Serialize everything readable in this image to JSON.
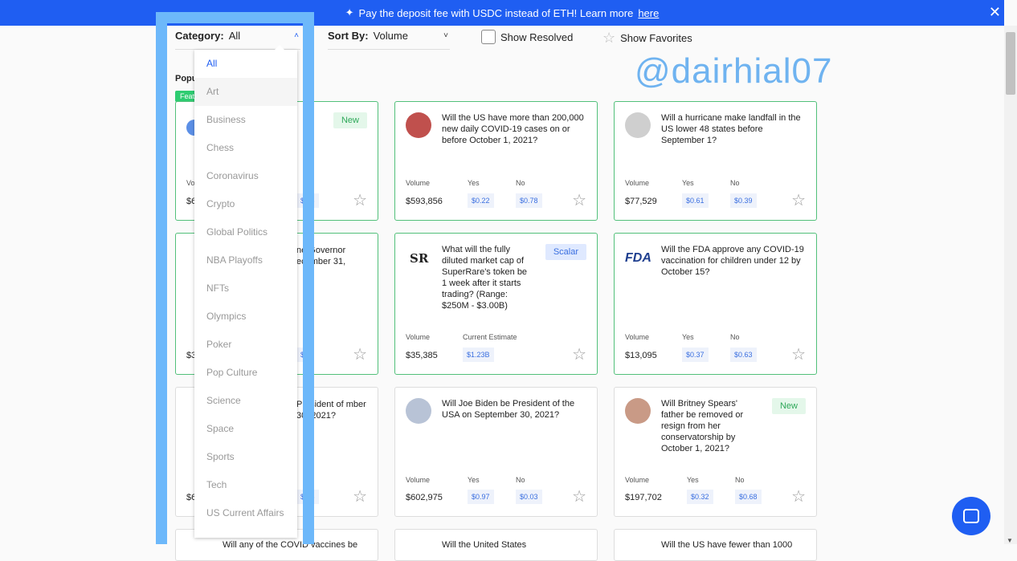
{
  "banner": {
    "text": "Pay the deposit fee with USDC instead of ETH! Learn more",
    "link": "here"
  },
  "filters": {
    "category_label": "Category:",
    "category_value": "All",
    "sort_label": "Sort By:",
    "sort_value": "Volume",
    "show_resolved": "Show Resolved",
    "show_favorites": "Show Favorites"
  },
  "watermark": "@dairhial07",
  "section": {
    "popular": "Popu",
    "featured": "Feat"
  },
  "menu": [
    "All",
    "Art",
    "Business",
    "Chess",
    "Coronavirus",
    "Crypto",
    "Global Politics",
    "NBA Playoffs",
    "NFTs",
    "Olympics",
    "Poker",
    "Pop Culture",
    "Science",
    "Space",
    "Sports",
    "Tech",
    "US Current Affairs"
  ],
  "cards": [
    {
      "question": "...",
      "badge": "New",
      "volume": "$6",
      "yes": "",
      "no": "$0.8"
    },
    {
      "question": "Will the US have more than 200,000 new daily COVID-19 cases on or before October 1, 2021?",
      "volume_label": "Volume",
      "yes_label": "Yes",
      "no_label": "No",
      "volume": "$593,856",
      "yes": "$0.22",
      "no": "$0.78"
    },
    {
      "question": "Will a hurricane make landfall in the US lower 48 states before September 1?",
      "volume_label": "Volume",
      "yes_label": "Yes",
      "no_label": "No",
      "volume": "$77,529",
      "yes": "$0.61",
      "no": "$0.39"
    },
    {
      "question": "ne Governor ecember 31,",
      "volume": "$3",
      "no": "$0"
    },
    {
      "question": "What will the fully diluted market cap of SuperRare's token be 1 week after it starts trading? (Range: $250M - $3.00B)",
      "badge": "Scalar",
      "volume_label": "Volume",
      "estimate_label": "Current Estimate",
      "volume": "$35,385",
      "estimate": "$1.23B",
      "logo": "SR"
    },
    {
      "question": "Will the FDA approve any COVID-19 vaccination for children under 12 by October 15?",
      "volume_label": "Volume",
      "yes_label": "Yes",
      "no_label": "No",
      "volume": "$13,095",
      "yes": "$0.37",
      "no": "$0.63",
      "logo": "FDA"
    },
    {
      "question": "President of mber 30, 2021?",
      "volume": "$6",
      "no": "$0.8"
    },
    {
      "question": "Will Joe Biden be President of the USA on September 30, 2021?",
      "volume_label": "Volume",
      "yes_label": "Yes",
      "no_label": "No",
      "volume": "$602,975",
      "yes": "$0.97",
      "no": "$0.03"
    },
    {
      "question": "Will Britney Spears' father be removed or resign from her conservatorship by October 1, 2021?",
      "badge": "New",
      "volume_label": "Volume",
      "yes_label": "Yes",
      "no_label": "No",
      "volume": "$197,702",
      "yes": "$0.32",
      "no": "$0.68"
    }
  ],
  "bottom_row": [
    "Will any of the COVID vaccines be",
    "Will the United States",
    "Will the US have fewer than 1000"
  ]
}
